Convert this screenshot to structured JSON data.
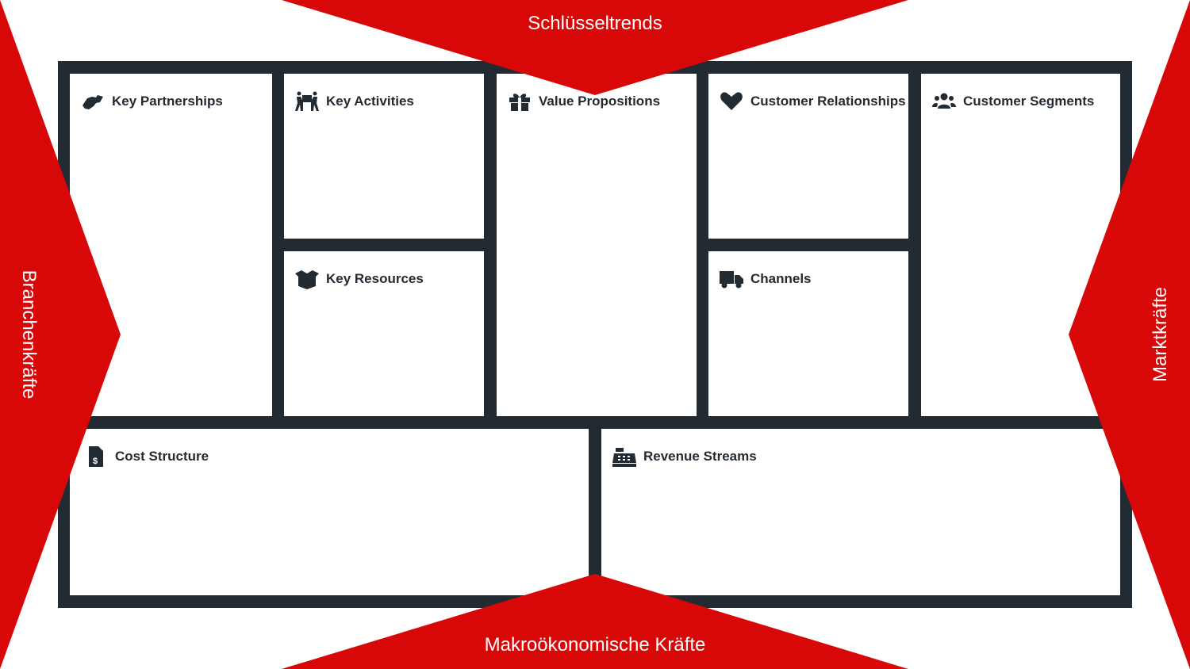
{
  "colors": {
    "accent": "#d90808",
    "frame": "#222a32",
    "text": "#222a32"
  },
  "forces": {
    "top": "Schlüsseltrends",
    "bottom": "Makroökonomische Kräfte",
    "left": "Branchenkräfte",
    "right": "Marktkräfte"
  },
  "blocks": {
    "key_partnerships": {
      "label": "Key Partnerships",
      "icon": "handshake-icon"
    },
    "key_activities": {
      "label": "Key Activities",
      "icon": "people-carry-icon"
    },
    "key_resources": {
      "label": "Key Resources",
      "icon": "open-box-icon"
    },
    "value_propositions": {
      "label": "Value Propositions",
      "icon": "gift-icon"
    },
    "customer_relationships": {
      "label": "Customer Relationships",
      "icon": "heart-icon"
    },
    "channels": {
      "label": "Channels",
      "icon": "truck-icon"
    },
    "customer_segments": {
      "label": "Customer Segments",
      "icon": "users-icon"
    },
    "cost_structure": {
      "label": "Cost Structure",
      "icon": "invoice-dollar-icon"
    },
    "revenue_streams": {
      "label": "Revenue Streams",
      "icon": "cash-register-icon"
    }
  }
}
